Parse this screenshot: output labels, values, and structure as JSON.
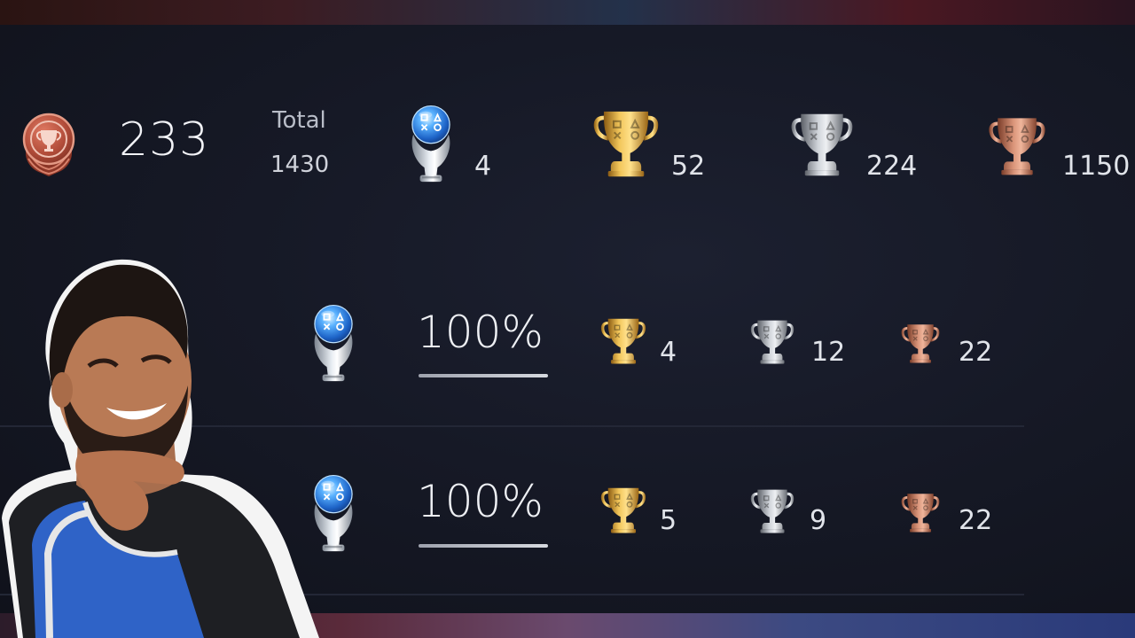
{
  "summary": {
    "level": "233",
    "total_label": "Total",
    "total_value": "1430",
    "platinum": "4",
    "gold": "52",
    "silver": "224",
    "bronze": "1150"
  },
  "games": [
    {
      "completion": "100%",
      "gold": "4",
      "silver": "12",
      "bronze": "22"
    },
    {
      "completion": "100%",
      "gold": "5",
      "silver": "9",
      "bronze": "22"
    }
  ],
  "colors": {
    "background": "#10121b",
    "gold": "#d4a23c",
    "silver": "#b7bcc4",
    "bronze": "#c97e62",
    "platinum_orb": "#2d86e6",
    "level_badge": "#b8513f"
  },
  "icons": [
    "level-badge-icon",
    "platinum-trophy-icon",
    "gold-trophy-icon",
    "silver-trophy-icon",
    "bronze-trophy-icon"
  ]
}
